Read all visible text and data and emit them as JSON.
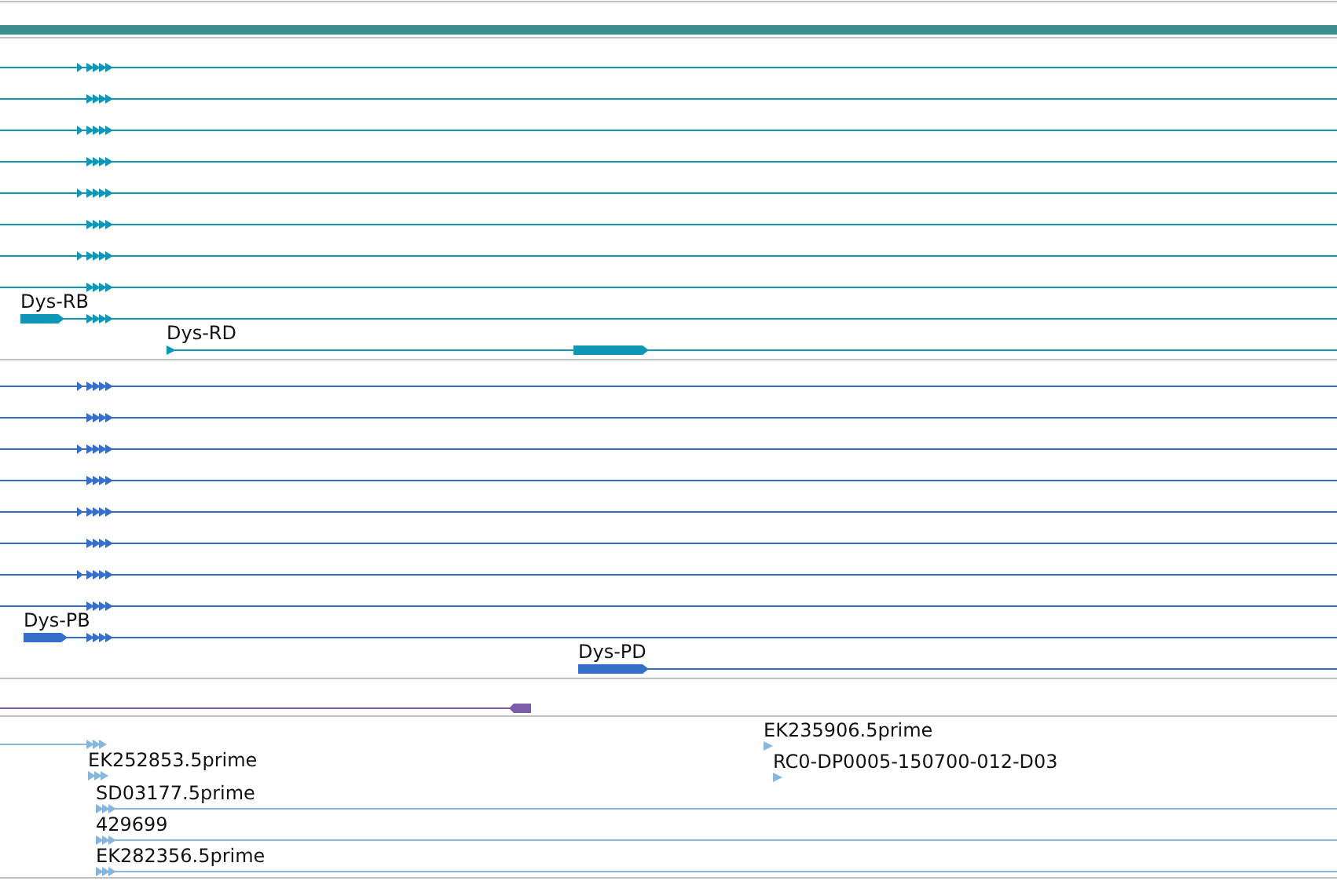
{
  "tracks": [
    {
      "kind": "transcripts",
      "color": "#0f97b8",
      "labels": [
        "Dys-RB",
        "Dys-RD"
      ]
    },
    {
      "kind": "transcripts",
      "color": "#346ec6",
      "labels": [
        "Dys-PB",
        "Dys-PD"
      ]
    },
    {
      "kind": "single",
      "color": "#7a5caa"
    },
    {
      "kind": "reads",
      "color": "#88b6dc",
      "labels": [
        "EK252853.5prime",
        "SD03177.5prime",
        "429699",
        "EK282356.5prime",
        "EK235906.5prime",
        "RC0-DP0005-150700-012-D03"
      ]
    }
  ]
}
